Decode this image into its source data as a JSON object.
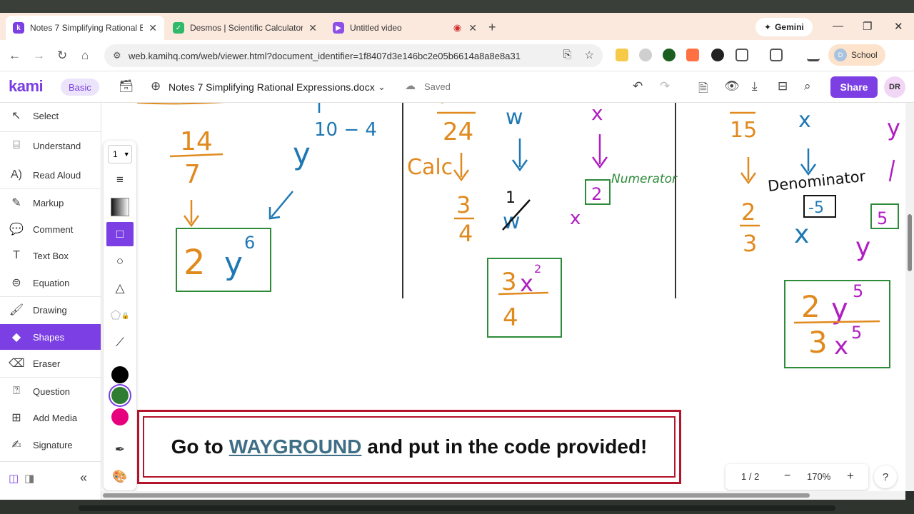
{
  "browser": {
    "tabs": [
      {
        "title": "Notes 7 Simplifying Rational Ex",
        "favicon": "kami-icon",
        "active": true
      },
      {
        "title": "Desmos | Scientific Calculator",
        "favicon": "desmos-icon",
        "active": false
      },
      {
        "title": "Untitled video",
        "favicon": "video-icon",
        "active": false
      }
    ],
    "gemini_label": "Gemini",
    "url": "web.kamihq.com/web/viewer.html?document_identifier=1f8407d3e146bc2e05b6614a8a8e8a31",
    "profile_initial": "D",
    "profile_label": "School"
  },
  "kami": {
    "logo": "kami",
    "plan": "Basic",
    "document_name": "Notes 7 Simplifying Rational Expressions.docx",
    "save_status": "Saved",
    "share_label": "Share",
    "user_initials": "DR"
  },
  "sidebar": {
    "items": [
      {
        "label": "Select",
        "icon": "cursor-icon"
      },
      {
        "label": "Understand",
        "icon": "understand-icon"
      },
      {
        "label": "Read Aloud",
        "icon": "read-aloud-icon"
      },
      {
        "label": "Markup",
        "icon": "markup-icon"
      },
      {
        "label": "Comment",
        "icon": "comment-icon"
      },
      {
        "label": "Text Box",
        "icon": "text-box-icon"
      },
      {
        "label": "Equation",
        "icon": "equation-icon"
      },
      {
        "label": "Drawing",
        "icon": "drawing-icon"
      },
      {
        "label": "Shapes",
        "icon": "shapes-icon",
        "active": true
      },
      {
        "label": "Eraser",
        "icon": "eraser-icon"
      },
      {
        "label": "Question",
        "icon": "question-icon"
      },
      {
        "label": "Add Media",
        "icon": "add-media-icon"
      },
      {
        "label": "Signature",
        "icon": "signature-icon"
      }
    ]
  },
  "palette": {
    "stroke_width": "1",
    "colors": [
      "#000000",
      "#2e7d32",
      "#e6007e"
    ],
    "selected_color": "#2e7d32"
  },
  "document": {
    "handwriting": {
      "frac1_num": "14",
      "frac1_den": "7",
      "exp_label": "10 − 4",
      "var_y": "y",
      "result1_coef": "2",
      "result1_var": "y",
      "result1_exp": "6",
      "frac2_den": "24",
      "calc_label": "Calc",
      "frac2_simpl_num": "3",
      "frac2_simpl_den": "4",
      "var_w": "w",
      "var_x": "x",
      "one": "1",
      "numerator_label": "Numerator",
      "boxed_two": "2",
      "result2_num_coef": "3",
      "result2_num_var": "x",
      "result2_num_exp": "2",
      "result2_den": "4",
      "frac3_den": "15",
      "frac3_simpl_num": "2",
      "frac3_simpl_den": "3",
      "denominator_label": "Denominator",
      "boxed_neg5": "-5",
      "boxed_five": "5",
      "result3_num_coef": "2",
      "result3_num_var": "y",
      "result3_num_exp": "5",
      "result3_den_coef": "3",
      "result3_den_var": "x",
      "result3_den_exp": "5"
    },
    "banner": {
      "prefix": "Go to",
      "link": "WAYGROUND",
      "suffix": "and put in the code provided!"
    }
  },
  "pager": {
    "page": "1 / 2",
    "zoom": "170%"
  },
  "colors": {
    "accent": "#7b3fe4",
    "orange": "#e08a1e",
    "blue": "#1f78b4",
    "magenta": "#b01fc1",
    "green": "#2e8b3a",
    "banner_red": "#b3132b"
  }
}
